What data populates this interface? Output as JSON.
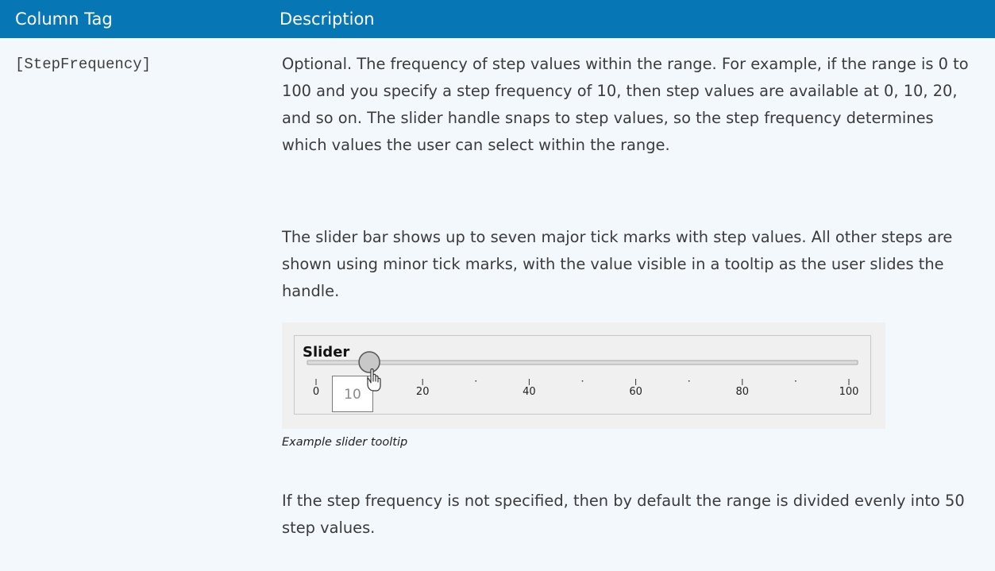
{
  "table": {
    "headers": {
      "column_tag": "Column Tag",
      "description": "Description"
    },
    "row": {
      "tag": "[StepFrequency]",
      "paragraphs": [
        "Optional. The frequency of step values within the range. For example, if the range is 0 to 100 and you specify a step frequency of 10, then step values are available at 0, 10, 20, and so on. The slider handle snaps to step values, so the step frequency determines which values the user can select within the range.",
        "The slider bar shows up to seven major tick marks with step values. All other steps are shown using minor tick marks, with the value visible in a tooltip as the user slides the handle.",
        "If the step frequency is not specified, then by default the range is divided evenly into 50 step values."
      ],
      "figure": {
        "label": "Slider",
        "tick_labels": [
          "0",
          "20",
          "40",
          "60",
          "80",
          "100"
        ],
        "range": [
          0,
          100
        ],
        "handle_value": 10,
        "tooltip_value": "10",
        "caption": "Example slider tooltip"
      }
    }
  },
  "colors": {
    "header_bg": "#0676b5",
    "row_bg": "#f3f8fc"
  }
}
